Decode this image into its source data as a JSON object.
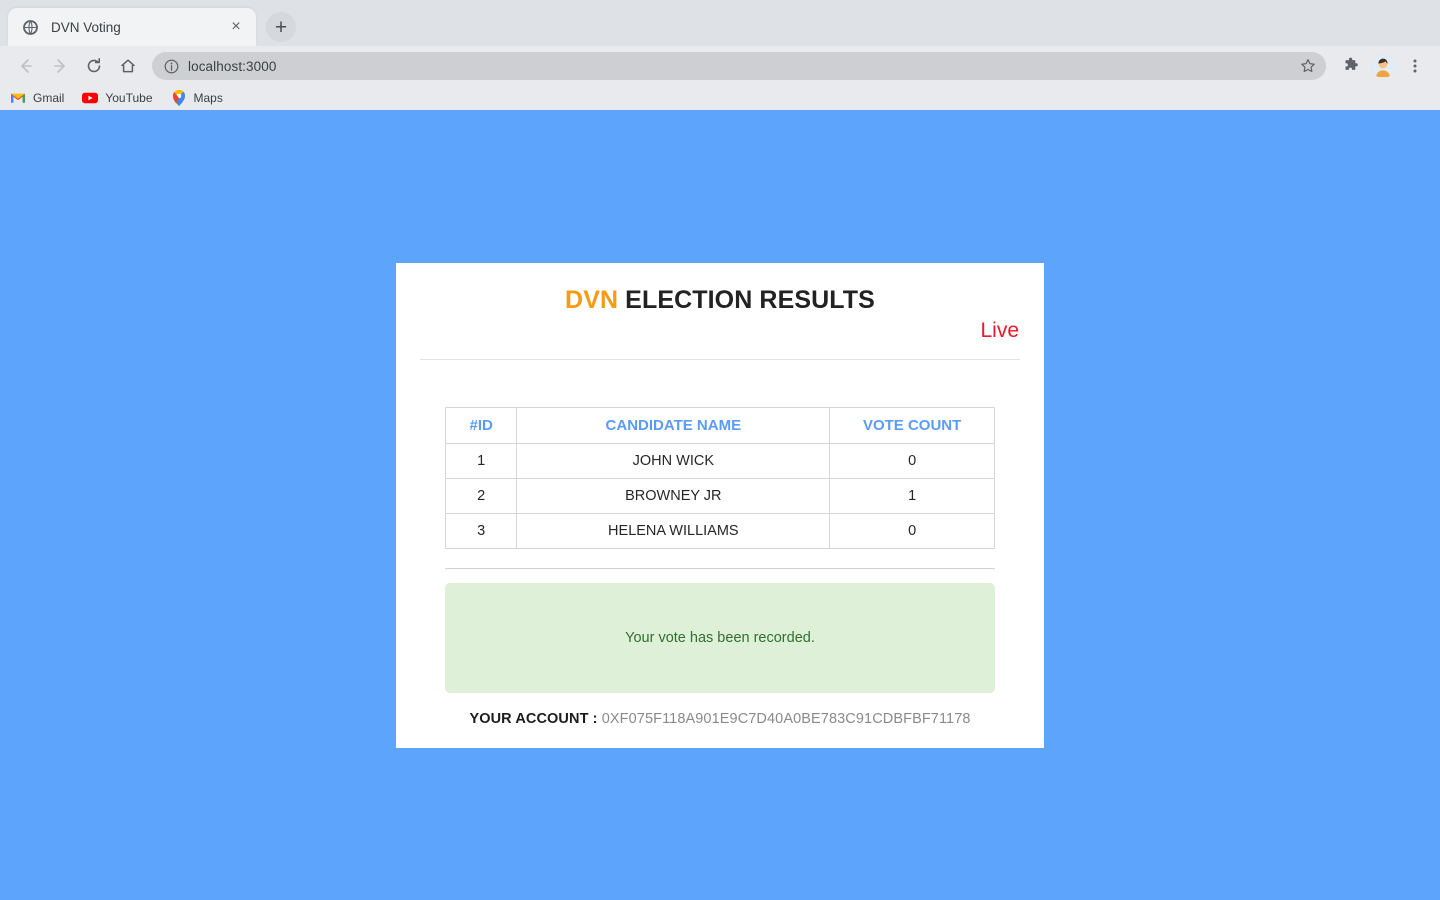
{
  "browser": {
    "tab": {
      "title": "DVN Voting",
      "favicon": "globe-icon",
      "close_label": "×"
    },
    "new_tab_label": "+",
    "nav": {
      "back_label": "←",
      "forward_label": "→",
      "reload_label": "↻",
      "home_label": "⌂"
    },
    "omnibox": {
      "url": "localhost:3000",
      "info_icon": "info-circle-icon",
      "star_icon": "star-icon"
    },
    "toolbar_icons": {
      "extensions": "puzzle-piece-icon",
      "profile": "avatar-icon",
      "menu": "three-dot-menu-icon"
    },
    "bookmarks": [
      {
        "label": "Gmail",
        "icon": "gmail-icon"
      },
      {
        "label": "YouTube",
        "icon": "youtube-icon"
      },
      {
        "label": "Maps",
        "icon": "google-maps-icon"
      }
    ]
  },
  "colors": {
    "page_background": "#5da4fc",
    "brand_orange": "#f79a16",
    "live_red": "#e8192c",
    "table_header_blue": "#5b9bf8",
    "alert_background": "#dff0d8",
    "alert_text": "#2f6f2f"
  },
  "card": {
    "title_brand": "DVN",
    "title_rest": " ELECTION RESULTS",
    "live_label": "Live",
    "table": {
      "headers": [
        "#ID",
        "CANDIDATE NAME",
        "VOTE COUNT"
      ],
      "rows": [
        {
          "id": "1",
          "name": "JOHN WICK",
          "votes": "0"
        },
        {
          "id": "2",
          "name": "BROWNEY JR",
          "votes": "1"
        },
        {
          "id": "3",
          "name": "HELENA WILLIAMS",
          "votes": "0"
        }
      ]
    },
    "alert_message": "Your vote has been recorded.",
    "account_label": "YOUR ACCOUNT :",
    "account_value": "0XF075F118A901E9C7D40A0BE783C91CDBFBF71178"
  }
}
